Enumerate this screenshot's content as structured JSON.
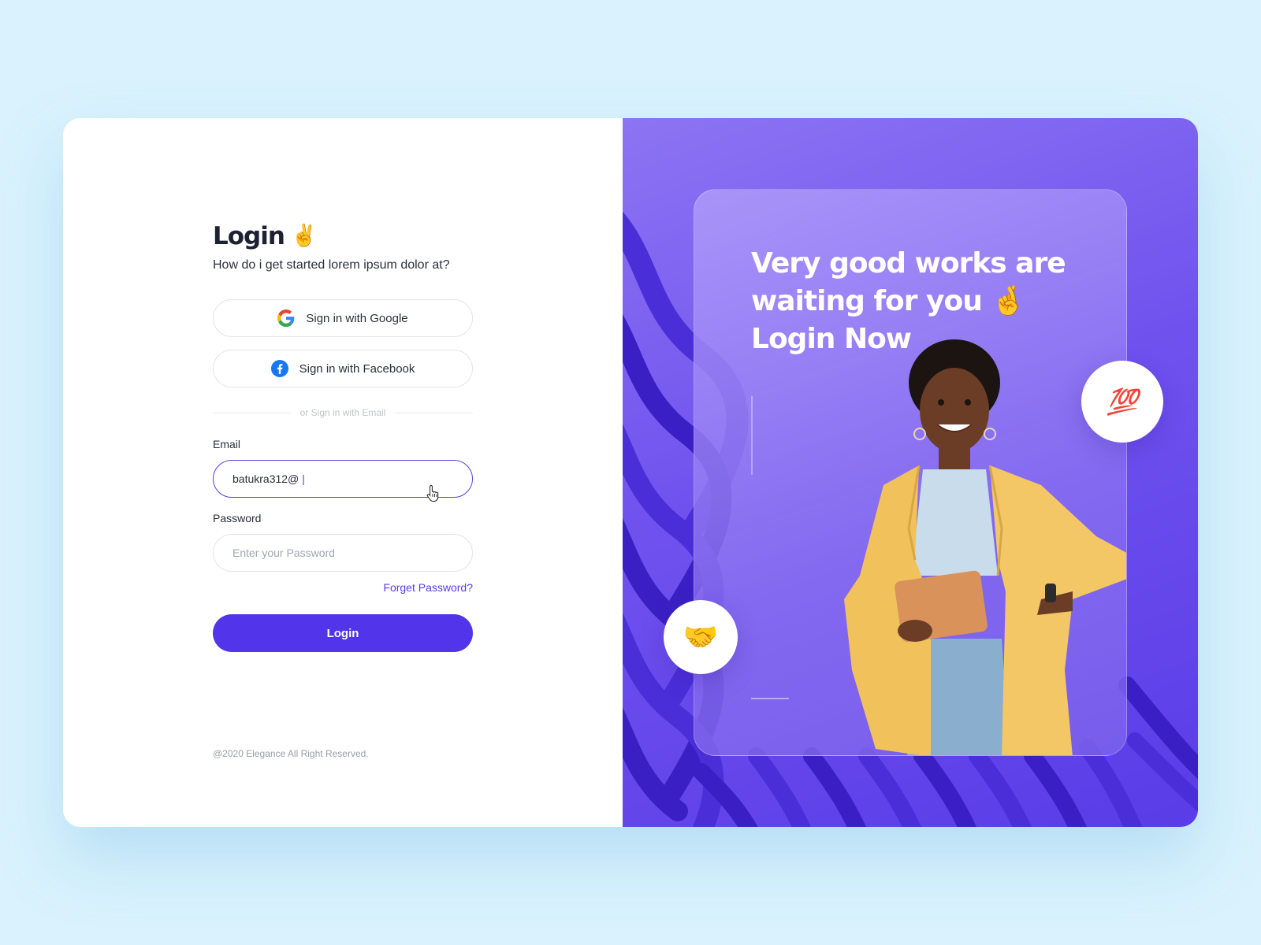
{
  "login": {
    "title": "Login",
    "title_emoji": "✌️",
    "subtitle": "How do i get started lorem ipsum dolor at?",
    "google_label": "Sign in with Google",
    "facebook_label": "Sign in with Facebook",
    "divider_text": "or Sign in with Email",
    "email_label": "Email",
    "email_value": "batukra312@",
    "password_label": "Password",
    "password_placeholder": "Enter your Password",
    "forgot_label": "Forget Password?",
    "login_button": "Login",
    "footer": "@2020 Elegance All Right Reserved."
  },
  "promo": {
    "headline_line1": "Very good works are",
    "headline_line2": "waiting for you 🤞",
    "headline_line3": "Login Now",
    "bubble_top": "💯",
    "bubble_bottom": "🤝"
  },
  "colors": {
    "accent": "#5235ea",
    "background": "#d9f2fd",
    "panel_gradient_start": "#8c74f3",
    "panel_gradient_end": "#5a3ce8"
  },
  "icons": [
    "google-icon",
    "facebook-icon",
    "hand-pointer-icon"
  ]
}
